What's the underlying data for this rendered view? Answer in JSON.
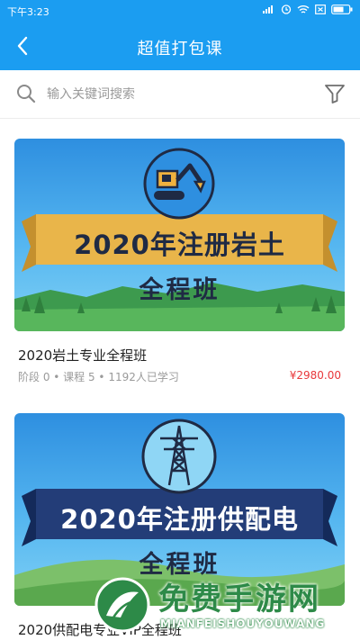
{
  "status_bar": {
    "time": "下午3:23"
  },
  "app_bar": {
    "title": "超值打包课"
  },
  "search": {
    "placeholder": "输入关键词搜索"
  },
  "courses": [
    {
      "banner_title": "2020年注册岩土",
      "banner_subtitle": "全程班",
      "title": "2020岩土专业全程班",
      "meta": "阶段 0 • 课程 5 • 1192人已学习",
      "price": "¥2980.00",
      "icon": "excavator-icon",
      "ribbon_color": "#e9b54a"
    },
    {
      "banner_title": "2020年注册供配电",
      "banner_subtitle": "全程班",
      "title": "2020供配电专业VIP全程班",
      "icon": "power-tower-icon",
      "ribbon_color": "#233d78"
    }
  ],
  "watermark": {
    "text": "免费手游网",
    "subtext": "MIANFEISHOUYOUWANG"
  },
  "colors": {
    "primary": "#1b9df1",
    "price": "#e8373a"
  }
}
